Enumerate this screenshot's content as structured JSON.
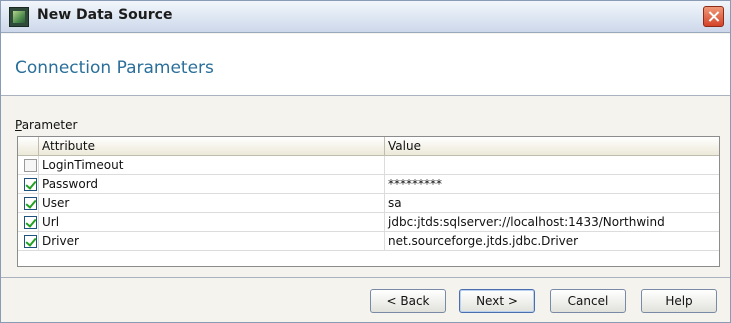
{
  "window": {
    "title": "New Data Source"
  },
  "header": {
    "title": "Connection Parameters"
  },
  "parameter": {
    "label_prefix": "P",
    "label_rest": "arameter",
    "columns": {
      "attribute": "Attribute",
      "value": "Value"
    },
    "rows": [
      {
        "checked": false,
        "attribute": "LoginTimeout",
        "value": ""
      },
      {
        "checked": true,
        "attribute": "Password",
        "value": "*********"
      },
      {
        "checked": true,
        "attribute": "User",
        "value": "sa"
      },
      {
        "checked": true,
        "attribute": "Url",
        "value": "jdbc:jtds:sqlserver://localhost:1433/Northwind"
      },
      {
        "checked": true,
        "attribute": "Driver",
        "value": "net.sourceforge.jtds.jdbc.Driver"
      }
    ]
  },
  "buttons": {
    "back": "< Back",
    "next": "Next >",
    "cancel": "Cancel",
    "help": "Help"
  },
  "icons": {
    "app": "data-source-app-icon",
    "close": "close-icon"
  },
  "colors": {
    "title_accent": "#2a6f9a",
    "check": "#21a121",
    "close": "#d4442a"
  }
}
